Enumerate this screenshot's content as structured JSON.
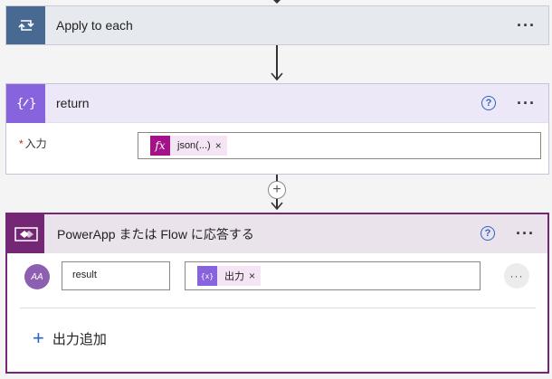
{
  "apply_each": {
    "title": "Apply to each",
    "more": "···"
  },
  "return_action": {
    "title": "return",
    "help": "?",
    "more": "···",
    "field_required": "*",
    "field_label": "入力",
    "token_label": "json(...)",
    "token_icon": "fx",
    "token_remove": "×"
  },
  "add_step": "+",
  "respond_action": {
    "title": "PowerApp または Flow に応答する",
    "help": "?",
    "more": "···",
    "avatar_text": "AA",
    "output_name": "result",
    "output_token_label": "出力",
    "output_token_icon": "{x}",
    "output_token_remove": "×",
    "row_more": "···",
    "add_output_plus": "+",
    "add_output_label": "出力追加"
  },
  "colors": {
    "apply_each_icon": "#486991",
    "return_icon": "#8764dd",
    "respond_icon": "#742774",
    "expression_token": "#a4128a",
    "variable_token": "#8764dd",
    "link": "#2b63c6"
  }
}
